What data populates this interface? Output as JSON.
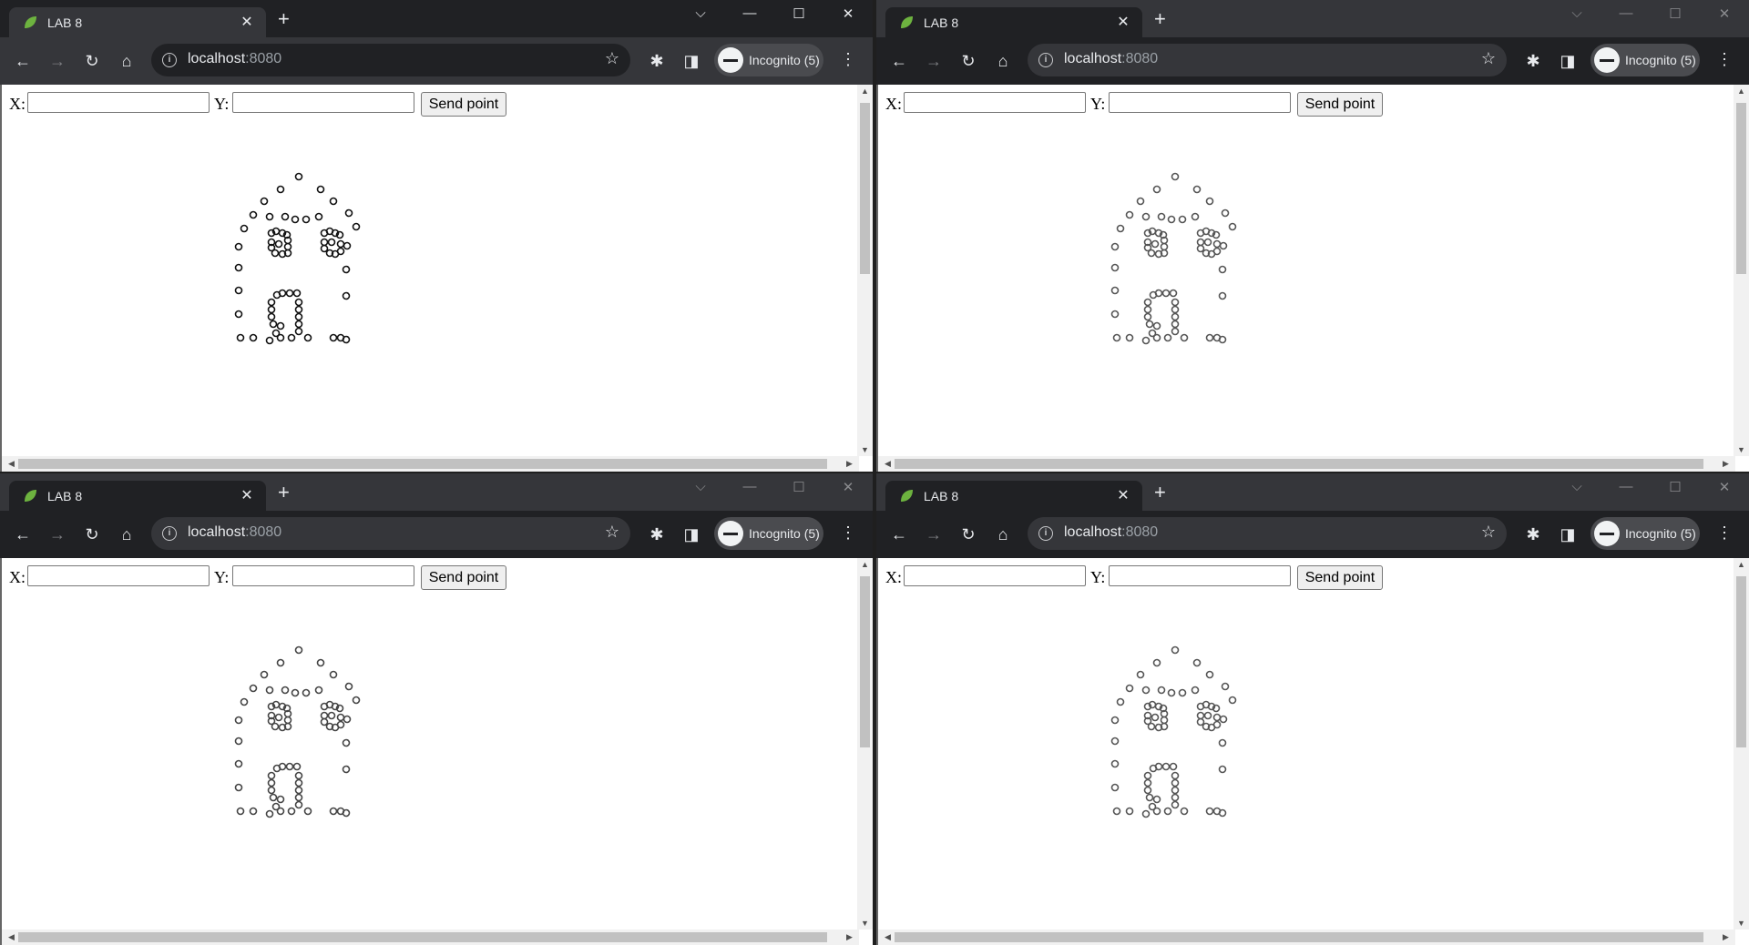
{
  "windows": [
    {
      "tab_title": "LAB 8",
      "url_host": "localhost",
      "url_port": ":8080",
      "incognito_label": "Incognito (5)",
      "x_label": "X:",
      "y_label": "Y:",
      "x_value": "",
      "y_value": "",
      "send_label": "Send point",
      "point_color": "#111111"
    },
    {
      "tab_title": "LAB 8",
      "url_host": "localhost",
      "url_port": ":8080",
      "incognito_label": "Incognito (5)",
      "x_label": "X:",
      "y_label": "Y:",
      "x_value": "",
      "y_value": "",
      "send_label": "Send point",
      "point_color": "#555555"
    },
    {
      "tab_title": "LAB 8",
      "url_host": "localhost",
      "url_port": ":8080",
      "incognito_label": "Incognito (5)",
      "x_label": "X:",
      "y_label": "Y:",
      "x_value": "",
      "y_value": "",
      "send_label": "Send point",
      "point_color": "#444444"
    },
    {
      "tab_title": "LAB 8",
      "url_host": "localhost",
      "url_port": ":8080",
      "incognito_label": "Incognito (5)",
      "x_label": "X:",
      "y_label": "Y:",
      "x_value": "",
      "y_value": "",
      "send_label": "Send point",
      "point_color": "#555555"
    }
  ],
  "icons": {
    "favicon": "spring-leaf-icon",
    "close": "close-icon",
    "new_tab": "plus-icon",
    "back": "arrow-left-icon",
    "forward": "arrow-right-icon",
    "reload": "reload-icon",
    "home": "home-icon",
    "site_info": "info-icon",
    "bookmark": "star-icon",
    "extensions": "puzzle-icon",
    "side_panel": "side-panel-icon",
    "incognito": "incognito-icon",
    "menu": "kebab-menu-icon"
  },
  "accent_colors": {
    "favicon": "#6db33f",
    "chrome_dark": "#202124",
    "chrome_mid": "#35363a"
  },
  "canvas_points": [
    [
      0,
      -52
    ],
    [
      -20,
      -38
    ],
    [
      24,
      -38
    ],
    [
      -38,
      -25
    ],
    [
      38,
      -25
    ],
    [
      -50,
      -10
    ],
    [
      55,
      -12
    ],
    [
      -60,
      5
    ],
    [
      63,
      3
    ],
    [
      -32,
      -8
    ],
    [
      -15,
      -8
    ],
    [
      -4,
      -5
    ],
    [
      8,
      -5
    ],
    [
      22,
      -8
    ],
    [
      -30,
      10
    ],
    [
      -25,
      8
    ],
    [
      -18,
      10
    ],
    [
      -13,
      12
    ],
    [
      -30,
      20
    ],
    [
      -30,
      26
    ],
    [
      -26,
      32
    ],
    [
      -18,
      33
    ],
    [
      -12,
      32
    ],
    [
      -12,
      25
    ],
    [
      -12,
      18
    ],
    [
      -22,
      22
    ],
    [
      28,
      10
    ],
    [
      34,
      8
    ],
    [
      40,
      10
    ],
    [
      45,
      12
    ],
    [
      28,
      20
    ],
    [
      28,
      27
    ],
    [
      34,
      32
    ],
    [
      40,
      33
    ],
    [
      46,
      30
    ],
    [
      46,
      22
    ],
    [
      36,
      20
    ],
    [
      -66,
      25
    ],
    [
      53,
      24
    ],
    [
      -66,
      48
    ],
    [
      52,
      50
    ],
    [
      -30,
      86
    ],
    [
      -24,
      78
    ],
    [
      -18,
      76
    ],
    [
      -10,
      76
    ],
    [
      -2,
      76
    ],
    [
      0,
      86
    ],
    [
      0,
      94
    ],
    [
      0,
      102
    ],
    [
      0,
      110
    ],
    [
      0,
      118
    ],
    [
      -30,
      94
    ],
    [
      -30,
      102
    ],
    [
      -28,
      110
    ],
    [
      -20,
      112
    ],
    [
      -25,
      120
    ],
    [
      -66,
      73
    ],
    [
      -66,
      99
    ],
    [
      -64,
      125
    ],
    [
      -50,
      125
    ],
    [
      -20,
      125
    ],
    [
      -32,
      128
    ],
    [
      -8,
      125
    ],
    [
      10,
      125
    ],
    [
      38,
      125
    ],
    [
      46,
      125
    ],
    [
      52,
      79
    ],
    [
      52,
      127
    ]
  ]
}
